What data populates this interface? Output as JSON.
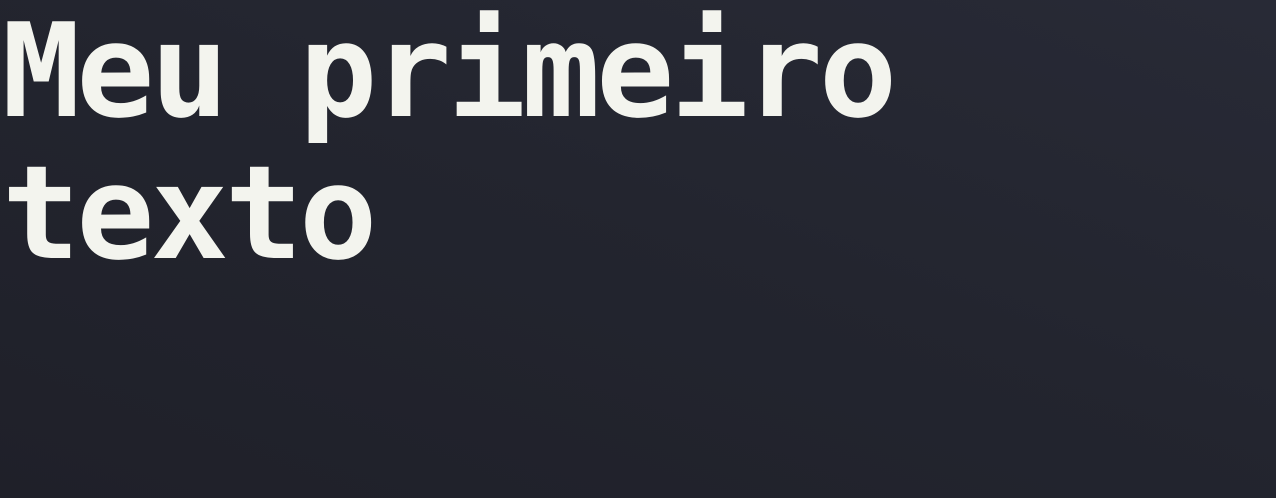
{
  "page": {
    "heading": "Meu primeiro texto"
  },
  "colors": {
    "background": "#24262f",
    "text": "#f3f4ee"
  }
}
